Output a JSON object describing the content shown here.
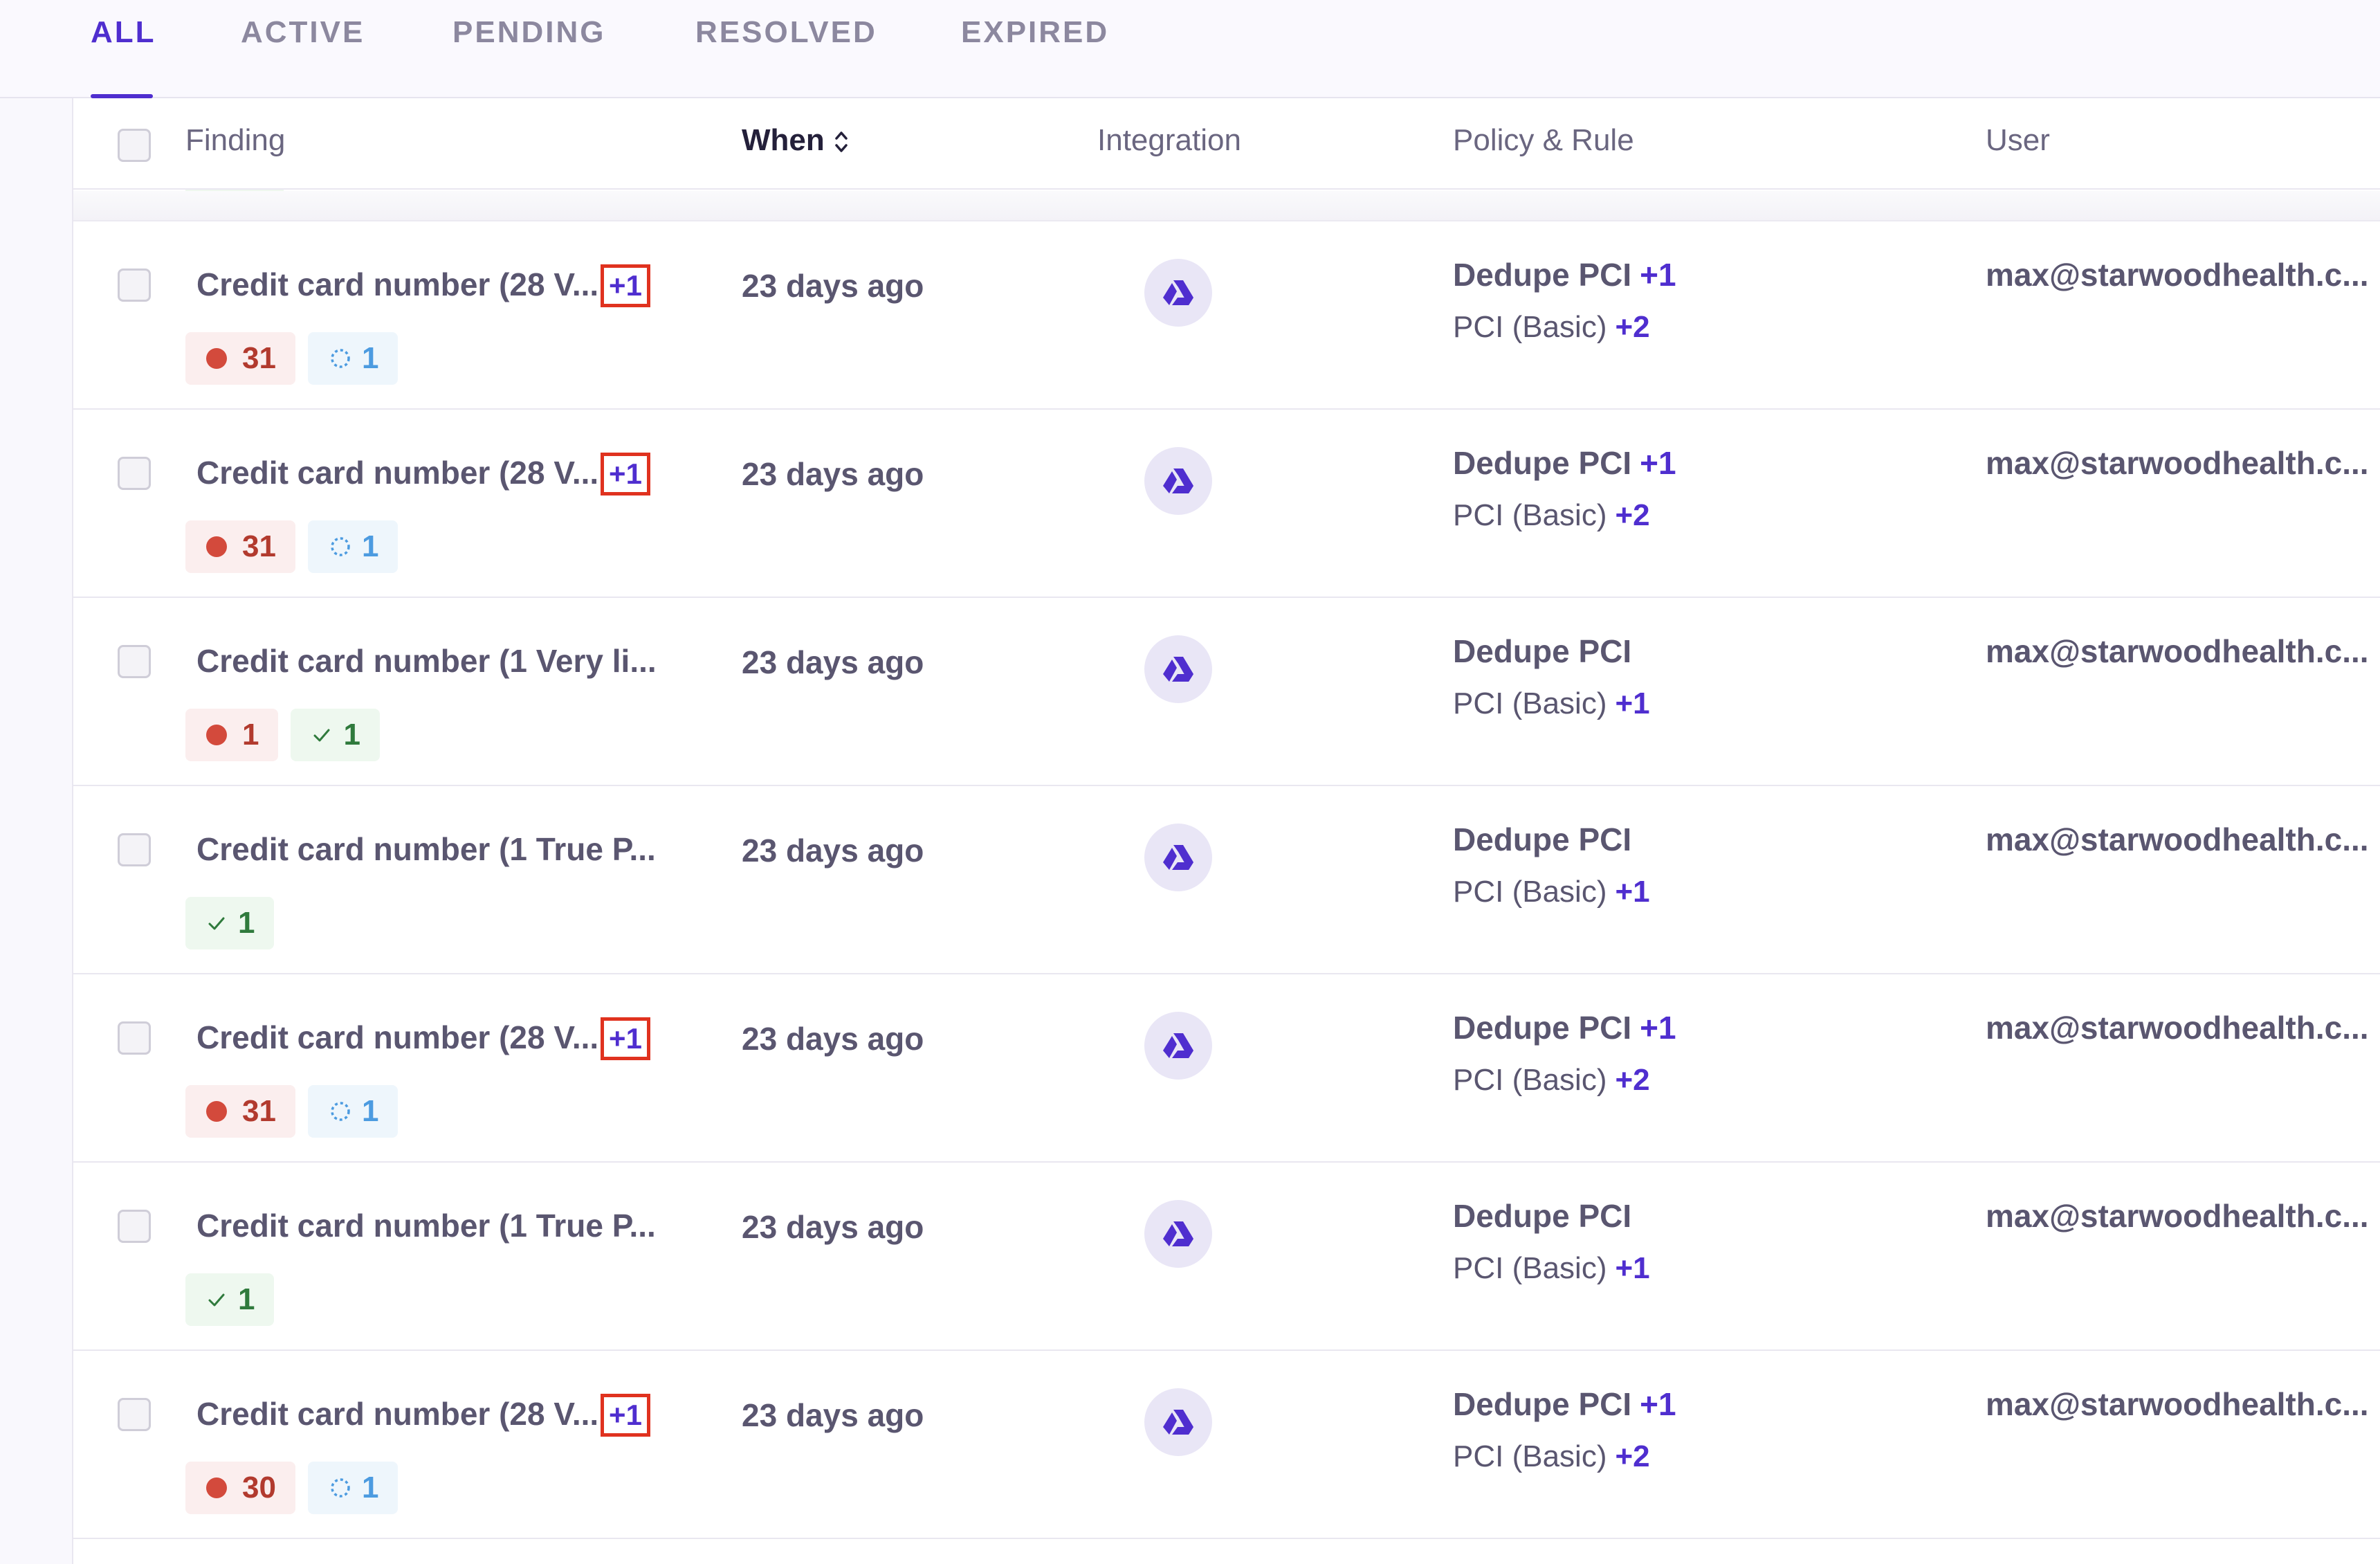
{
  "tabs": [
    {
      "label": "ALL",
      "active": true
    },
    {
      "label": "ACTIVE",
      "active": false
    },
    {
      "label": "PENDING",
      "active": false
    },
    {
      "label": "RESOLVED",
      "active": false
    },
    {
      "label": "EXPIRED",
      "active": false
    }
  ],
  "table": {
    "headers": {
      "finding": "Finding",
      "when": "When",
      "integration": "Integration",
      "policy_rule": "Policy & Rule",
      "user": "User"
    },
    "rows": [
      {
        "finding": "Credit card number (28 V...",
        "finding_plus": "+1",
        "badges": [
          {
            "kind": "red",
            "value": "31"
          },
          {
            "kind": "blue",
            "value": "1"
          }
        ],
        "when": "23 days ago",
        "integration_icon": "google-drive-icon",
        "policy": "Dedupe PCI",
        "policy_plus": "+1",
        "rule": "PCI (Basic)",
        "rule_plus": "+2",
        "user": "max@starwoodhealth.c..."
      },
      {
        "finding": "Credit card number (28 V...",
        "finding_plus": "+1",
        "badges": [
          {
            "kind": "red",
            "value": "31"
          },
          {
            "kind": "blue",
            "value": "1"
          }
        ],
        "when": "23 days ago",
        "integration_icon": "google-drive-icon",
        "policy": "Dedupe PCI",
        "policy_plus": "+1",
        "rule": "PCI (Basic)",
        "rule_plus": "+2",
        "user": "max@starwoodhealth.c..."
      },
      {
        "finding": "Credit card number (1 Very li...",
        "finding_plus": "",
        "badges": [
          {
            "kind": "red",
            "value": "1"
          },
          {
            "kind": "green",
            "value": "1"
          }
        ],
        "when": "23 days ago",
        "integration_icon": "google-drive-icon",
        "policy": "Dedupe PCI",
        "policy_plus": "",
        "rule": "PCI (Basic)",
        "rule_plus": "+1",
        "user": "max@starwoodhealth.c..."
      },
      {
        "finding": "Credit card number (1 True P...",
        "finding_plus": "",
        "badges": [
          {
            "kind": "green",
            "value": "1"
          }
        ],
        "when": "23 days ago",
        "integration_icon": "google-drive-icon",
        "policy": "Dedupe PCI",
        "policy_plus": "",
        "rule": "PCI (Basic)",
        "rule_plus": "+1",
        "user": "max@starwoodhealth.c..."
      },
      {
        "finding": "Credit card number (28 V...",
        "finding_plus": "+1",
        "badges": [
          {
            "kind": "red",
            "value": "31"
          },
          {
            "kind": "blue",
            "value": "1"
          }
        ],
        "when": "23 days ago",
        "integration_icon": "google-drive-icon",
        "policy": "Dedupe PCI",
        "policy_plus": "+1",
        "rule": "PCI (Basic)",
        "rule_plus": "+2",
        "user": "max@starwoodhealth.c..."
      },
      {
        "finding": "Credit card number (1 True P...",
        "finding_plus": "",
        "badges": [
          {
            "kind": "green",
            "value": "1"
          }
        ],
        "when": "23 days ago",
        "integration_icon": "google-drive-icon",
        "policy": "Dedupe PCI",
        "policy_plus": "",
        "rule": "PCI (Basic)",
        "rule_plus": "+1",
        "user": "max@starwoodhealth.c..."
      },
      {
        "finding": "Credit card number (28 V...",
        "finding_plus": "+1",
        "badges": [
          {
            "kind": "red",
            "value": "30"
          },
          {
            "kind": "blue",
            "value": "1"
          }
        ],
        "when": "23 days ago",
        "integration_icon": "google-drive-icon",
        "policy": "Dedupe PCI",
        "policy_plus": "+1",
        "rule": "PCI (Basic)",
        "rule_plus": "+2",
        "user": "max@starwoodhealth.c..."
      }
    ]
  },
  "colors": {
    "accent": "#4f2ecf",
    "highlight_box": "#e0321f",
    "badge_red": "#d34a3c",
    "badge_blue": "#4c9be0",
    "badge_green": "#2f7a3c"
  }
}
